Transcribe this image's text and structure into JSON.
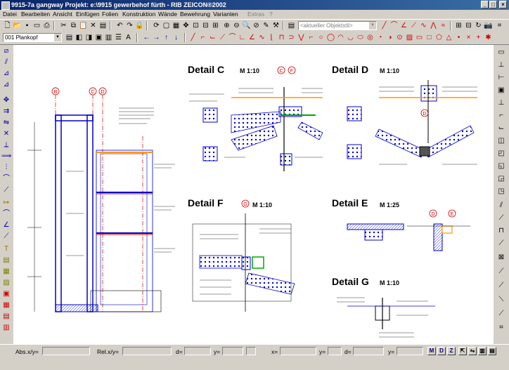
{
  "window": {
    "title": "9915-7a gangway  Projekt: e:\\9915 gewerbehof fürth  - RIB ZEICON®2002"
  },
  "menu": [
    {
      "label": "Datei",
      "enabled": true
    },
    {
      "label": "Bearbeiten",
      "enabled": true
    },
    {
      "label": "Ansicht",
      "enabled": true
    },
    {
      "label": "Einfügen",
      "enabled": true
    },
    {
      "label": "Folien",
      "enabled": true
    },
    {
      "label": "Konstruktion",
      "enabled": true
    },
    {
      "label": "Wände",
      "enabled": true
    },
    {
      "label": "Bewehrung",
      "enabled": true
    },
    {
      "label": "Varianten",
      "enabled": true
    },
    {
      "label": "Extras",
      "enabled": false
    },
    {
      "label": "?",
      "enabled": false
    }
  ],
  "toolbar": {
    "style_combo": "<aktueller Objektstil>",
    "layer_combo": "001 Plankopf"
  },
  "drawing": {
    "details": [
      {
        "title": "Detail C",
        "scale": "M 1:10",
        "markers": [
          "C",
          "F"
        ]
      },
      {
        "title": "Detail D",
        "scale": "M 1:10",
        "markers": [
          "D"
        ]
      },
      {
        "title": "Detail F",
        "scale": "M 1:10",
        "markers": [
          "G"
        ]
      },
      {
        "title": "Detail E",
        "scale": "M 1:25",
        "markers": [
          "D",
          "E"
        ]
      },
      {
        "title": "Detail G",
        "scale": "M 1:10",
        "markers": []
      }
    ],
    "axis_markers": [
      "B",
      "C",
      "D"
    ]
  },
  "statusbar": {
    "abs_label": "Abs.x/y=",
    "rel_label": "Rel.x/y=",
    "d_label": "d=",
    "y_label": "y=",
    "x_label": "x=",
    "mode_buttons": [
      "M",
      "D",
      "Z"
    ]
  },
  "colors": {
    "titlebar_start": "#0a246a",
    "titlebar_end": "#3a6ea5",
    "marker_red": "#cc0000",
    "drawing_blue": "#0000cc"
  }
}
